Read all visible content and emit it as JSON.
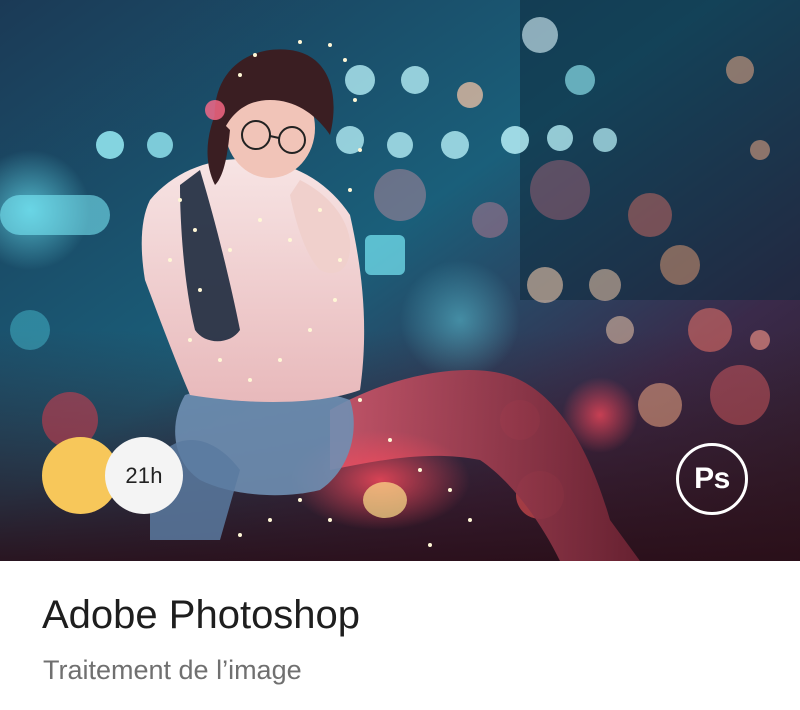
{
  "card": {
    "badge_time": "21h",
    "app_logo_text": "Ps",
    "title": "Adobe Photoshop",
    "subtitle": "Traitement de l’image"
  },
  "colors": {
    "accent_yellow": "#f7c75a",
    "time_badge_bg": "#f4f4f4",
    "title_text": "#1e1e1e",
    "subtitle_text": "#707070"
  },
  "icons": {
    "app_logo": "photoshop-icon"
  }
}
